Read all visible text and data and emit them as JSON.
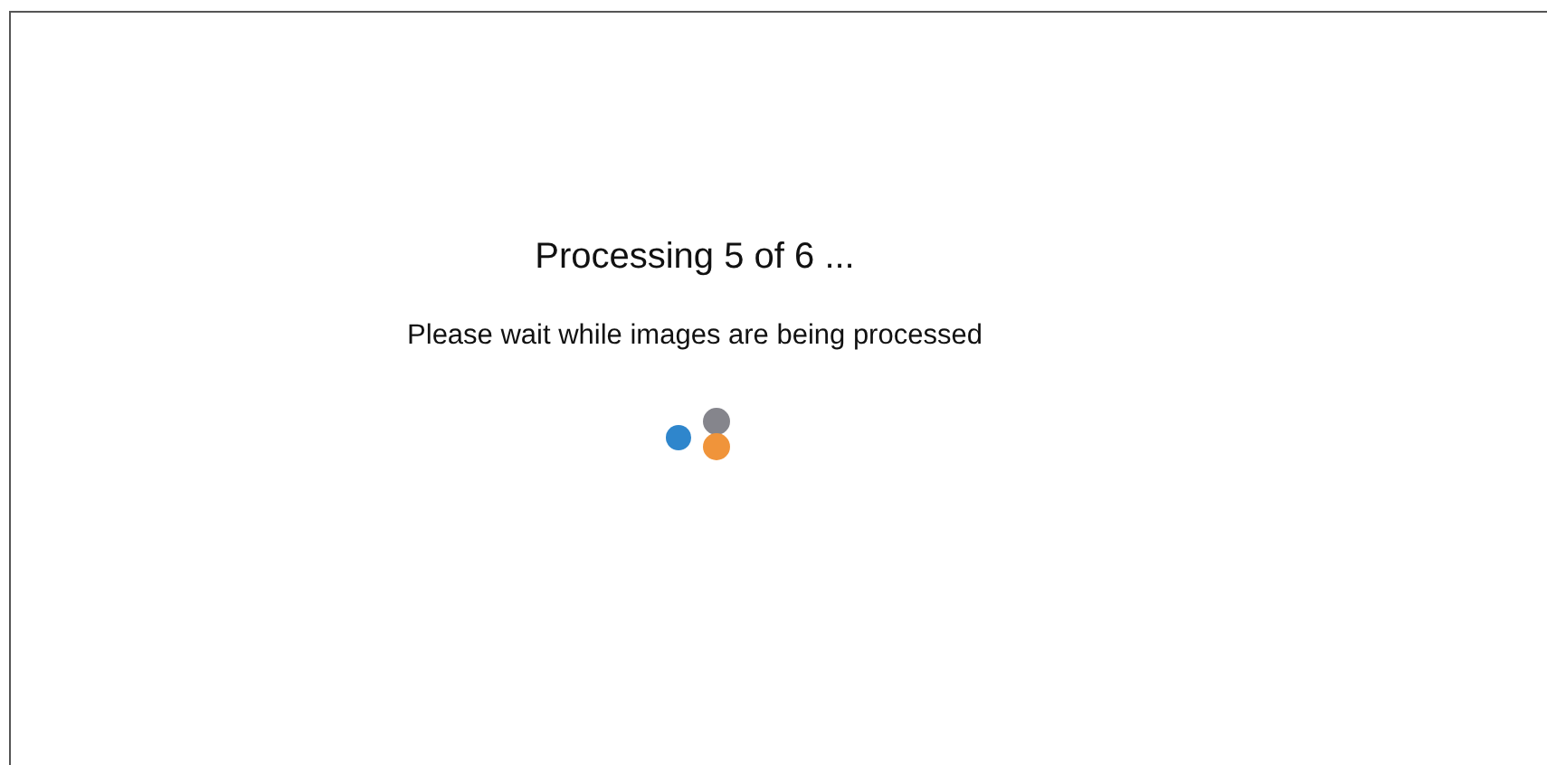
{
  "dialog": {
    "title": "Processing 5 of 6 ...",
    "message": "Please wait while images are being processed"
  }
}
